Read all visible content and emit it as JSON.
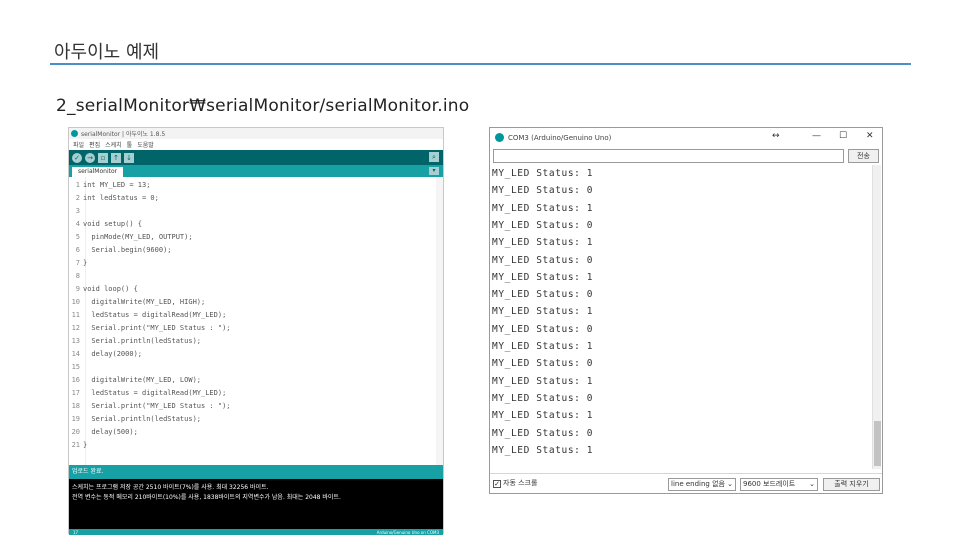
{
  "slide": {
    "title": "아두이노 예제",
    "path": "2_serialMonitor₩serialMonitor/serialMonitor.ino"
  },
  "ide": {
    "title": "serialMonitor | 아두이노 1.8.5",
    "menu": [
      "파일",
      "편집",
      "스케치",
      "툴",
      "도움말"
    ],
    "toolbar_icons": [
      "verify-icon",
      "upload-icon",
      "new-icon",
      "open-icon",
      "save-icon",
      "serial-monitor-icon"
    ],
    "tab": "serialMonitor",
    "code": [
      {
        "n": "1",
        "t": "int MY_LED = 13;"
      },
      {
        "n": "2",
        "t": "int ledStatus = 0;"
      },
      {
        "n": "3",
        "t": ""
      },
      {
        "n": "4",
        "t": "void setup() {"
      },
      {
        "n": "5",
        "t": "  pinMode(MY_LED, OUTPUT);"
      },
      {
        "n": "6",
        "t": "  Serial.begin(9600);"
      },
      {
        "n": "7",
        "t": "}"
      },
      {
        "n": "8",
        "t": ""
      },
      {
        "n": "9",
        "t": "void loop() {"
      },
      {
        "n": "10",
        "t": "  digitalWrite(MY_LED, HIGH);"
      },
      {
        "n": "11",
        "t": "  ledStatus = digitalRead(MY_LED);"
      },
      {
        "n": "12",
        "t": "  Serial.print(\"MY_LED Status : \");"
      },
      {
        "n": "13",
        "t": "  Serial.println(ledStatus);"
      },
      {
        "n": "14",
        "t": "  delay(2000);"
      },
      {
        "n": "15",
        "t": ""
      },
      {
        "n": "16",
        "t": "  digitalWrite(MY_LED, LOW);"
      },
      {
        "n": "17",
        "t": "  ledStatus = digitalRead(MY_LED);"
      },
      {
        "n": "18",
        "t": "  Serial.print(\"MY_LED Status : \");"
      },
      {
        "n": "19",
        "t": "  Serial.println(ledStatus);"
      },
      {
        "n": "20",
        "t": "  delay(500);"
      },
      {
        "n": "21",
        "t": "}"
      }
    ],
    "status": "업로드 완료.",
    "console": [
      "스케치는 프로그램 저장 공간 2510 바이트(7%)를 사용. 최대 32256 바이트.",
      "전역 변수는 동적 메모리 210바이트(10%)를 사용, 1838바이트의 지역변수가 남음.  최대는 2048 바이트."
    ],
    "bottom_left": "17",
    "bottom_right": "Arduino/Genuino Uno on COM3"
  },
  "serial_monitor": {
    "title": "COM3 (Arduino/Genuino Uno)",
    "send_label": "전송",
    "input_value": "",
    "lines": [
      "MY_LED Status: 1",
      "MY_LED Status: 0",
      "MY_LED Status: 1",
      "MY_LED Status: 0",
      "MY_LED Status: 1",
      "MY_LED Status: 0",
      "MY_LED Status: 1",
      "MY_LED Status: 0",
      "MY_LED Status: 1",
      "MY_LED Status: 0",
      "MY_LED Status: 1",
      "MY_LED Status: 0",
      "MY_LED Status: 1",
      "MY_LED Status: 0",
      "MY_LED Status: 1",
      "MY_LED Status: 0",
      "MY_LED Status: 1"
    ],
    "autoscroll_label": "자동 스크롤",
    "autoscroll_checked": true,
    "line_ending": "line ending 없음",
    "baud": "9600 보드레이트",
    "clear_label": "출력 지우기"
  }
}
